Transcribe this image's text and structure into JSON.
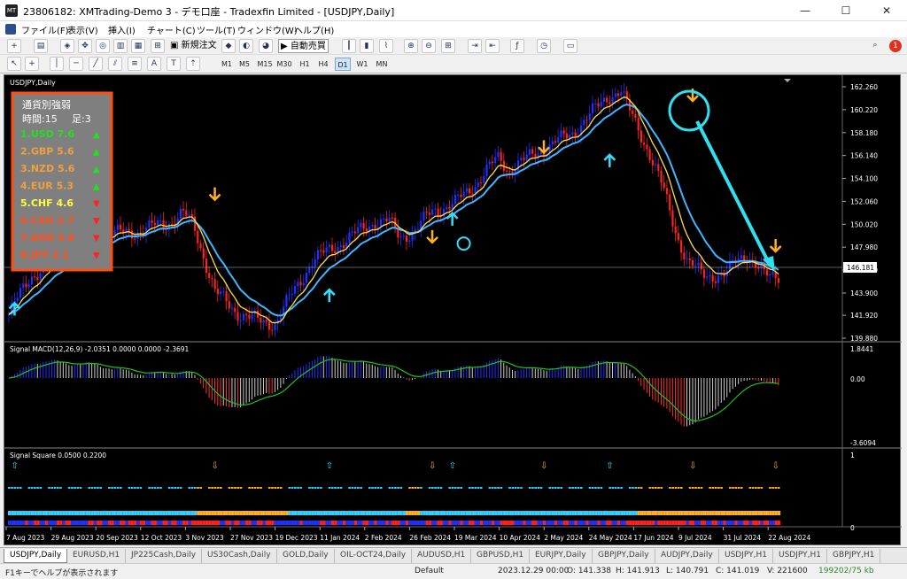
{
  "window": {
    "title": "23806182: XMTrading-Demo 3 - デモ口座 - Tradexfin Limited - [USDJPY,Daily]",
    "min": "—",
    "max": "☐",
    "close": "✕"
  },
  "menu": [
    "ファイル(F)",
    "表示(V)",
    "挿入(I)",
    "チャート(C)",
    "ツール(T)",
    "ウィンドウ(W)",
    "ヘルプ(H)"
  ],
  "toolbar": {
    "new_order": "新規注文",
    "auto_trading": "自動売買",
    "notification_count": "1",
    "timeframes": [
      "M1",
      "M5",
      "M15",
      "M30",
      "H1",
      "H4",
      "D1",
      "W1",
      "MN"
    ],
    "active_timeframe": "D1"
  },
  "chart": {
    "symbol_label": "USDJPY,Daily",
    "current_price": "146.181",
    "price_ticks": [
      "162.260",
      "160.220",
      "158.180",
      "156.140",
      "154.100",
      "152.060",
      "150.020",
      "147.980",
      "145.940",
      "143.900",
      "141.920",
      "139.880"
    ],
    "date_ticks": [
      "7 Aug 2023",
      "29 Aug 2023",
      "20 Sep 2023",
      "12 Oct 2023",
      "3 Nov 2023",
      "27 Nov 2023",
      "19 Dec 2023",
      "11 Jan 2024",
      "2 Feb 2024",
      "26 Feb 2024",
      "19 Mar 2024",
      "10 Apr 2024",
      "2 May 2024",
      "24 May 2024",
      "17 Jun 2024",
      "9 Jul 2024",
      "31 Jul 2024",
      "22 Aug 2024"
    ],
    "strength_panel": {
      "title": "通貨別強弱",
      "time_label": "時間:15",
      "bars_label": "足:3",
      "rows": [
        {
          "label": "1.USD 7.6",
          "dir": "▲",
          "color": "#22e022",
          "arrow_color": "#22e022"
        },
        {
          "label": "2.GBP 5.6",
          "dir": "▲",
          "color": "#f0a040",
          "arrow_color": "#22e022"
        },
        {
          "label": "3.NZD 5.6",
          "dir": "▲",
          "color": "#f0a040",
          "arrow_color": "#22e022"
        },
        {
          "label": "4.EUR 5.3",
          "dir": "▲",
          "color": "#f0a040",
          "arrow_color": "#22e022"
        },
        {
          "label": "5.CHF 4.6",
          "dir": "▼",
          "color": "#ffff40",
          "arrow_color": "#ff2020"
        },
        {
          "label": "6.CAD 2.7",
          "dir": "▼",
          "color": "#ff5020",
          "arrow_color": "#ff2020"
        },
        {
          "label": "7.AUD 2.6",
          "dir": "▼",
          "color": "#ff5020",
          "arrow_color": "#ff2020"
        },
        {
          "label": "8.JPY 2.1",
          "dir": "▼",
          "color": "#ff5020",
          "arrow_color": "#ff2020"
        }
      ]
    },
    "macd": {
      "label": "Signal MACD(12,26,9) -2.0351 0.0000 0.0000 -2.3691",
      "ticks": [
        "1.8441",
        "0.00",
        "-3.6094"
      ]
    },
    "square": {
      "label": "Signal Square 0.0500 0.2200",
      "ticks": [
        "1",
        "0"
      ]
    }
  },
  "tabs": [
    "USDJPY,Daily",
    "EURUSD,H1",
    "JP225Cash,Daily",
    "US30Cash,Daily",
    "GOLD,Daily",
    "OIL-OCT24,Daily",
    "AUDUSD,H1",
    "GBPUSD,H1",
    "EURJPY,Daily",
    "GBPJPY,Daily",
    "AUDJPY,Daily",
    "USDJPY,H1",
    "USDJPY,H1",
    "GBPJPY,H1"
  ],
  "status": {
    "help": "F1キーでヘルプが表示されます",
    "profile": "Default",
    "datetime": "2023.12.29 00:00",
    "open": "O: 141.338",
    "high": "H: 141.913",
    "low": "L: 140.791",
    "close": "C: 141.019",
    "volume": "V: 221600",
    "traffic": "199202/75 kb"
  },
  "colors": {
    "up_candle": "#2030ff",
    "down_candle": "#ff2020",
    "ma_fast": "#ffe040",
    "ma_slow": "#3fb6ff",
    "arrow_up": "#30e0ff",
    "arrow_down": "#ffb020",
    "annotation": "#2ee0f0"
  }
}
